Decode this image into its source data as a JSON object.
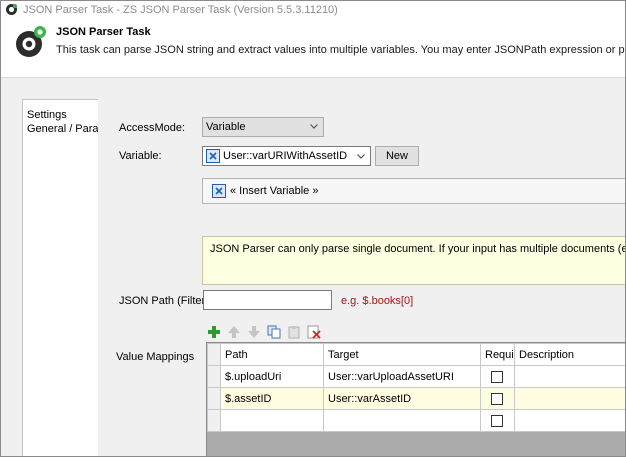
{
  "window": {
    "title": "JSON Parser Task - ZS JSON Parser Task (Version 5.5.3.11210)"
  },
  "header": {
    "title": "JSON Parser Task",
    "description": "This task can parse JSON string and extract values into multiple variables. You may enter JSONPath expression or property nam"
  },
  "sidebar": {
    "items": [
      {
        "label": "Settings"
      },
      {
        "label": "General / Parar"
      }
    ]
  },
  "form": {
    "access_mode_label": "AccessMode:",
    "access_mode_value": "Variable",
    "variable_label": "Variable:",
    "variable_value": "User::varURIWithAssetID",
    "new_button": "New",
    "insert_variable": "« Insert Variable »",
    "warning": "JSON Parser can only parse single document. If your input has multiple documents (e.g. {..}{..}",
    "json_path_label": "JSON Path (Filter)",
    "json_path_value": "",
    "json_path_hint": "e.g. $.books[0]",
    "value_mappings_label": "Value Mappings"
  },
  "mappings": {
    "columns": [
      "Path",
      "Target",
      "Requi",
      "Description"
    ],
    "rows": [
      {
        "path": "$.uploadUri",
        "target": "User::varUploadAssetURI",
        "required": false,
        "description": ""
      },
      {
        "path": "$.assetID",
        "target": "User::varAssetID",
        "required": false,
        "description": ""
      },
      {
        "path": "",
        "target": "",
        "required": false,
        "description": ""
      }
    ]
  },
  "icons": {
    "app": "json-parser-app-icon",
    "logo": "zs-logo-icon",
    "variable": "variable-x-icon",
    "toolbar": [
      "add-icon",
      "move-up-icon",
      "move-down-icon",
      "copy-icon",
      "paste-icon",
      "delete-icon"
    ]
  },
  "colors": {
    "warning_bg": "#ffffe1",
    "hint_text": "#a31515",
    "selected_row": "#fffde1",
    "add_icon": "#2e9a2e",
    "variable_icon": "#1e5eb8"
  }
}
